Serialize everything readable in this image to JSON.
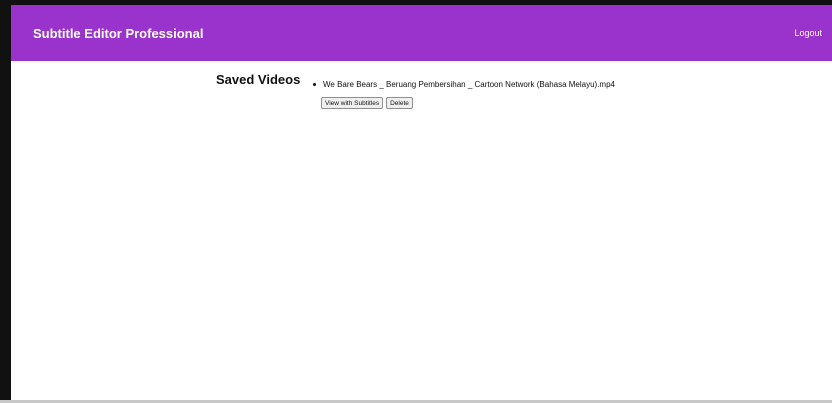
{
  "header": {
    "app_title": "Subtitle Editor Professional",
    "logout_label": "Logout",
    "background_color": "#9933cc"
  },
  "main": {
    "section_title": "Saved Videos",
    "videos": [
      {
        "filename": "We Bare Bears _ Beruang Pembersihan _ Cartoon Network (Bahasa Melayu).mp4",
        "view_label": "View with Subtitles",
        "delete_label": "Delete"
      }
    ]
  }
}
